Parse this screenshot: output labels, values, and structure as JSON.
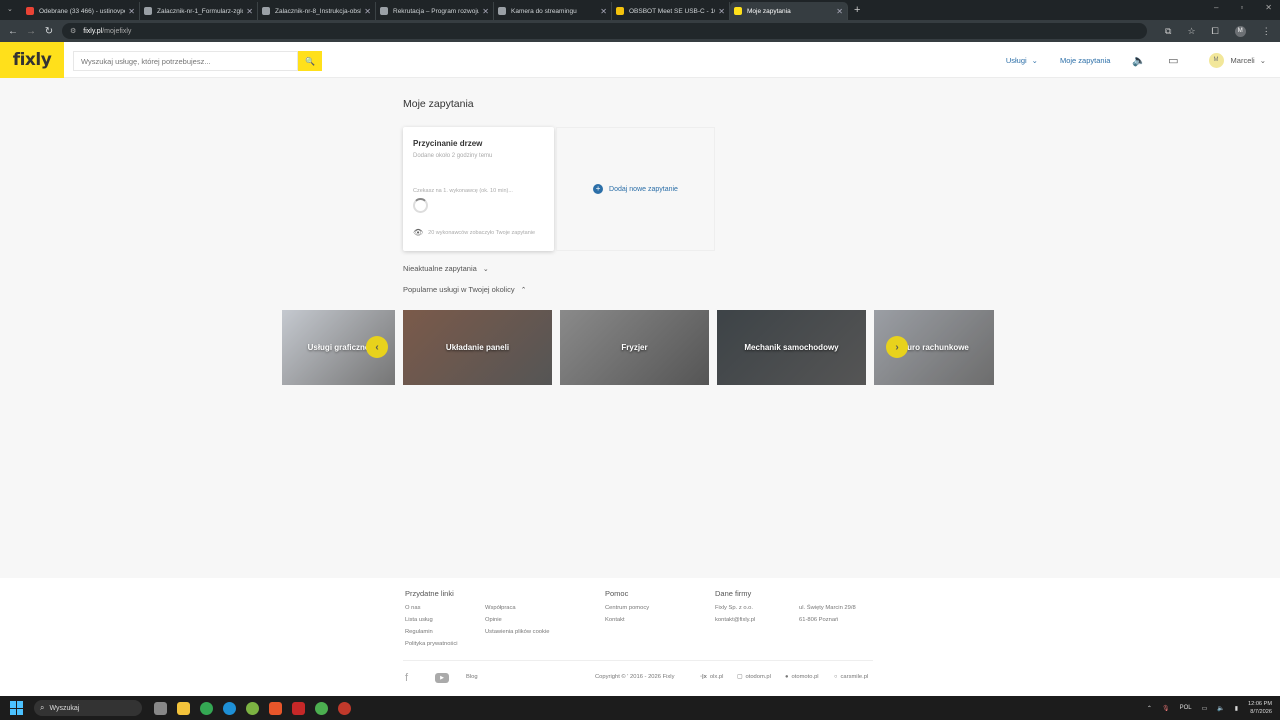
{
  "browser": {
    "tabs": [
      {
        "title": "Odebrane (33 466) - ustinovpe",
        "favicon_color": "#ea4335",
        "icon": "gmail-icon"
      },
      {
        "title": "Zalacznik-nr-1_Formularz-zglo",
        "favicon_color": "#9aa0a6",
        "icon": "document-icon"
      },
      {
        "title": "Zalacznik-nr-8_Instrukcja-obsl",
        "favicon_color": "#9aa0a6",
        "icon": "document-icon"
      },
      {
        "title": "Rekrutacja – Program rozwoju",
        "favicon_color": "#9aa0a6",
        "icon": "globe-icon"
      },
      {
        "title": "Kamera do streamingu",
        "favicon_color": "#9aa0a6",
        "icon": "chat-icon"
      },
      {
        "title": "OBSBOT Meet SE USB-C - 1080",
        "favicon_color": "#f4c20d",
        "icon": "obsbot-icon"
      },
      {
        "title": "Moje zapytania",
        "favicon_color": "#ffe01b",
        "icon": "fixly-icon",
        "active": true
      }
    ],
    "new_tab": "+",
    "url_domain": "fixly.pl",
    "url_path": "/mojefixly",
    "profile_initial": "M"
  },
  "site": {
    "logo": "fixly",
    "search_placeholder": "Wyszukaj usługę, której potrzebujesz...",
    "nav_services": "Usługi",
    "nav_my_requests": "Moje zapytania",
    "user_initial": "M",
    "user_name": "Marceli",
    "brand_color": "#ffe01b",
    "link_color": "#2c6fa8"
  },
  "main": {
    "title": "Moje zapytania",
    "request_card": {
      "title": "Przycinanie drzew",
      "posted": "Dodane około 2 godziny temu",
      "waiting": "Czekasz na 1. wykonawcę (ok. 10 min)...",
      "views": "20 wykonawców zobaczyło Twoje zapytanie"
    },
    "add_new": "Dodaj nowe zapytanie",
    "inactive": "Nieaktualne zapytania",
    "popular": "Popularne usługi w Twojej okolicy",
    "services": [
      {
        "label": "Usługi graficzne",
        "color": "#b9bec6"
      },
      {
        "label": "Układanie paneli",
        "color": "#7b5a4a"
      },
      {
        "label": "Fryzjer",
        "color": "#8a8a8a"
      },
      {
        "label": "Mechanik samochodowy",
        "color": "#3d4347"
      },
      {
        "label": "Biuro rachunkowe",
        "color": "#8b8f96"
      }
    ]
  },
  "footer": {
    "useful_heading": "Przydatne linki",
    "useful_col1": [
      "O nas",
      "Lista usług",
      "Regulamin",
      "Polityka prywatności"
    ],
    "useful_col2": [
      "Współpraca",
      "Opinie",
      "Ustawienia plików cookie"
    ],
    "help_heading": "Pomoc",
    "help_links": [
      "Centrum pomocy",
      "Kontakt"
    ],
    "company_heading": "Dane firmy",
    "company_col1": [
      "Fixly Sp. z o.o.",
      "kontakt@fixly.pl"
    ],
    "company_col2": [
      "ul. Święty Marcin 29/8",
      "61-806 Poznań"
    ],
    "blog": "Blog",
    "copyright": "Copyright © ' 2016 - 2026 Fixly",
    "partners": [
      "olx.pl",
      "otodom.pl",
      "otomoto.pl",
      "carsmile.pl"
    ]
  },
  "taskbar": {
    "search": "Wyszukaj",
    "lang": "POL",
    "time": "12:06 PM",
    "date": "8/7/2026"
  }
}
